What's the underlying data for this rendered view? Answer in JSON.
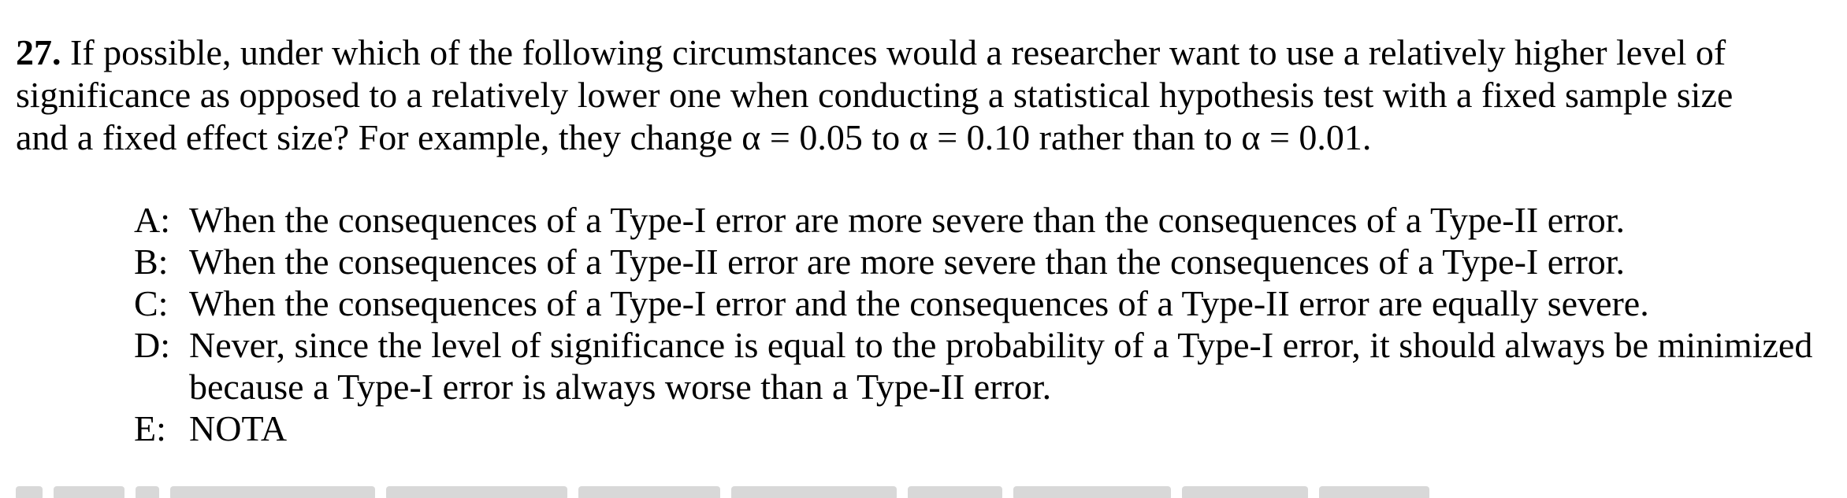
{
  "question": {
    "number": "27.",
    "text": " If possible, under which of the following circumstances would a researcher want to use a relatively higher level of significance as opposed to a relatively lower one when conducting a statistical hypothesis test with a fixed sample size and a fixed effect size?  For example, they change α = 0.05 to α = 0.10 rather than to α = 0.01."
  },
  "choices": [
    {
      "letter": "A:",
      "text": "When the consequences of a Type-I error are more severe than the consequences of a Type-II error."
    },
    {
      "letter": "B:",
      "text": "When the consequences of a Type-II error are more severe than the consequences of a Type-I error."
    },
    {
      "letter": "C:",
      "text": "When the consequences of a Type-I error and the consequences of a Type-II error are equally severe."
    },
    {
      "letter": "D:",
      "text": "Never, since the level of significance is equal to the probability of a Type-I error, it should always be minimized because a Type-I error is always worse than a Type-II error."
    },
    {
      "letter": "E:",
      "text": "NOTA"
    }
  ]
}
